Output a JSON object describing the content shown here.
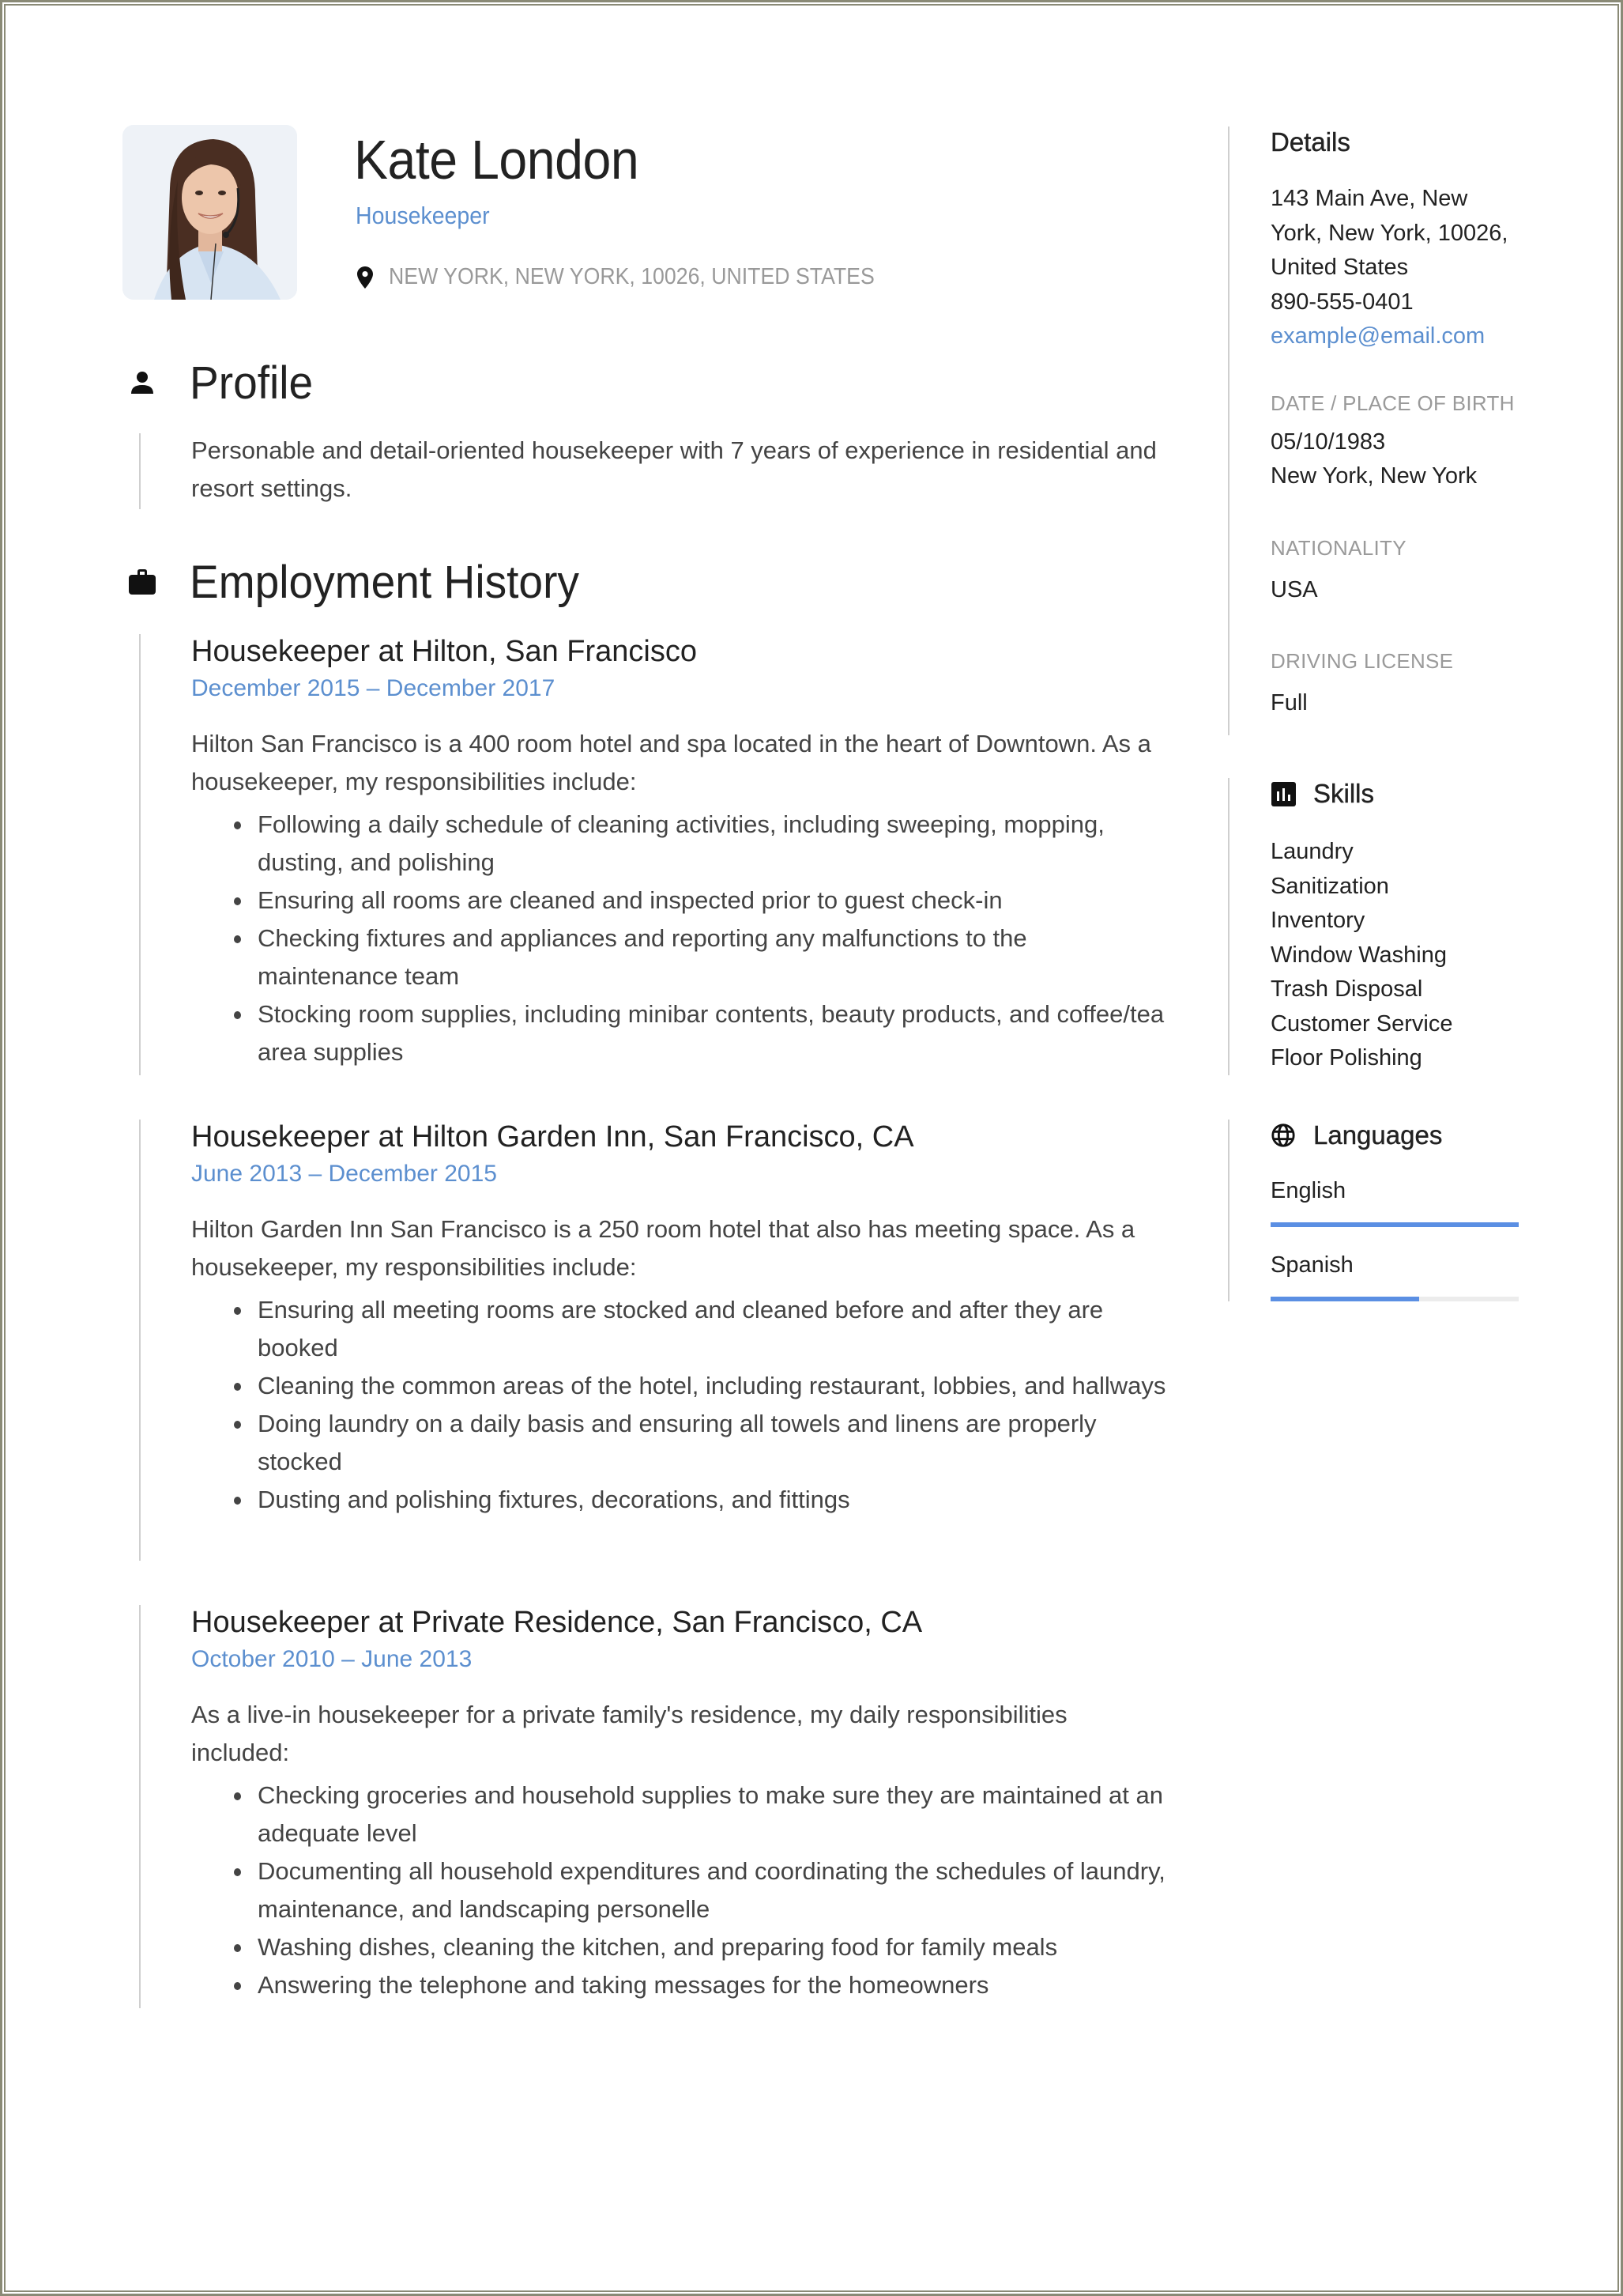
{
  "header": {
    "name": "Kate London",
    "job_title": "Housekeeper",
    "location": "NEW YORK, NEW YORK, 10026, UNITED STATES",
    "avatar_alt": "Profile photo of woman wearing a headset"
  },
  "profile": {
    "heading": "Profile",
    "icon": "person-icon",
    "summary": "Personable and detail-oriented housekeeper with 7 years of experience in residential and resort settings."
  },
  "employment": {
    "heading": "Employment History",
    "icon": "briefcase-icon",
    "jobs": [
      {
        "title": "Housekeeper at Hilton, San Francisco",
        "dates": "December 2015  –  December 2017",
        "description": "Hilton San Francisco is a 400 room hotel and spa located in the heart of Downtown. As a housekeeper, my responsibilities include:",
        "bullets": [
          "Following a daily schedule of cleaning activities, including sweeping, mopping, dusting, and polishing",
          "Ensuring all rooms are cleaned and inspected prior to guest check-in",
          "Checking fixtures and appliances and reporting any malfunctions to the maintenance team",
          "Stocking room supplies, including minibar contents, beauty products, and coffee/tea area supplies"
        ]
      },
      {
        "title": "Housekeeper at Hilton Garden Inn, San Francisco, CA",
        "dates": "June 2013  –  December 2015",
        "description": "Hilton Garden Inn San Francisco is a 250 room hotel that also has meeting space. As a housekeeper, my responsibilities include:",
        "bullets": [
          "Ensuring all meeting rooms are stocked and cleaned before and after they are booked",
          "Cleaning the common areas of the hotel, including restaurant, lobbies, and hallways",
          "Doing laundry on a daily basis and ensuring all towels and linens are properly stocked",
          "Dusting and polishing fixtures, decorations, and fittings"
        ]
      },
      {
        "title": "Housekeeper at Private Residence, San Francisco, CA",
        "dates": "October 2010  –  June 2013",
        "description": "As a live-in housekeeper for a private family's residence, my daily responsibilities included:",
        "bullets": [
          "Checking groceries and household supplies to make sure they are maintained at an adequate level",
          "Documenting all household expenditures and coordinating the schedules of laundry, maintenance, and landscaping personelle",
          "Washing dishes, cleaning the kitchen, and preparing food for family meals",
          "Answering the telephone and taking messages for the homeowners"
        ]
      }
    ]
  },
  "details": {
    "heading": "Details",
    "address_lines": [
      "143 Main Ave, New",
      "York, New York, 10026,",
      "United States"
    ],
    "phone": "890-555-0401",
    "email": "example@email.com",
    "birth_label": "DATE / PLACE OF BIRTH",
    "birth_date": "05/10/1983",
    "birth_place": "New York, New York",
    "nationality_label": "NATIONALITY",
    "nationality": "USA",
    "license_label": "DRIVING LICENSE",
    "license": "Full"
  },
  "skills": {
    "heading": "Skills",
    "icon": "bar-chart-icon",
    "items": [
      "Laundry",
      "Sanitization",
      "Inventory",
      "Window Washing",
      "Trash Disposal",
      "Customer Service",
      "Floor Polishing"
    ]
  },
  "languages": {
    "heading": "Languages",
    "icon": "globe-icon",
    "items": [
      {
        "name": "English",
        "level": 1.0
      },
      {
        "name": "Spanish",
        "level": 0.6
      }
    ]
  },
  "colors": {
    "accent": "#5c8fcf",
    "bar_fill": "#5b8fe3",
    "bar_track": "#ececec",
    "muted_label": "#9a9a9a",
    "text": "#222222",
    "frame": "#8a8a76"
  }
}
